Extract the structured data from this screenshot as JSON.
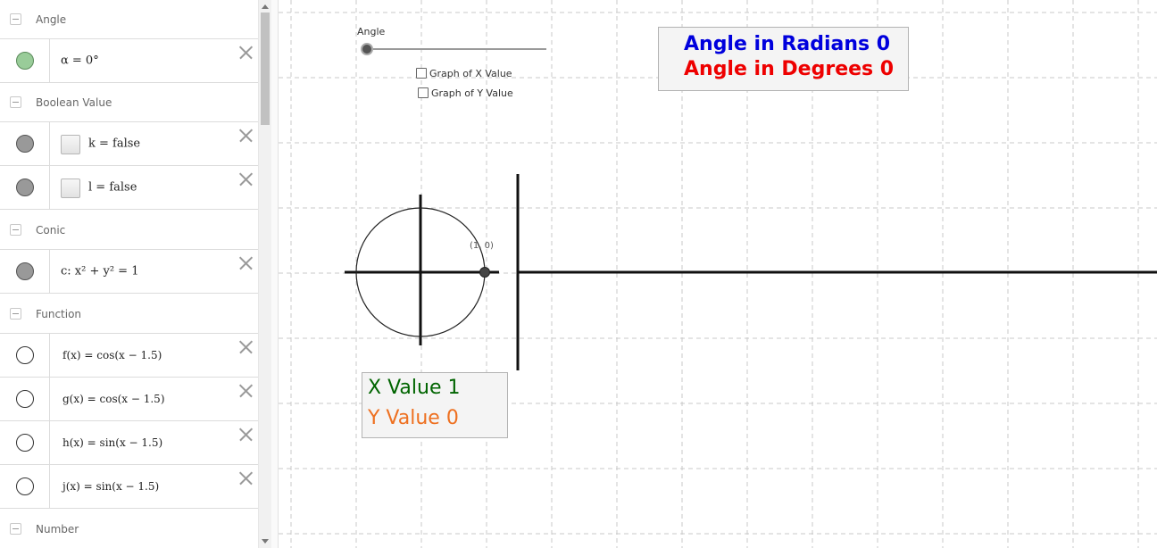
{
  "algebra": {
    "groups": {
      "angle": "Angle",
      "boolean": "Boolean Value",
      "conic": "Conic",
      "function": "Function",
      "number": "Number"
    },
    "items": {
      "alpha": "α = 0°",
      "k": "k = false",
      "l": "l = false",
      "c": "c: x² + y² = 1",
      "f": "f(x)  =  cos(x − 1.5)",
      "g": "g(x)  =  cos(x − 1.5)",
      "h": "h(x)  =  sin(x − 1.5)",
      "j": "j(x)  =  sin(x − 1.5)"
    }
  },
  "graphics": {
    "slider_label": "Angle",
    "slider_value_fraction": 0,
    "checkboxes": {
      "x": "Graph of X Value",
      "y": "Graph of Y Value"
    },
    "angle_box": {
      "radians": "Angle in Radians  0",
      "degrees": "Angle in Degrees  0"
    },
    "value_box": {
      "x": "X Value  1",
      "y": "Y Value  0"
    },
    "point_label": "(1, 0)"
  },
  "colors": {
    "radians": "#0000dd",
    "degrees": "#ee0000",
    "x_value": "#006400",
    "y_value": "#ee7020",
    "alpha_marble": "#99cc99",
    "grey_marble": "#999999",
    "grid": "#c8c8c8"
  }
}
